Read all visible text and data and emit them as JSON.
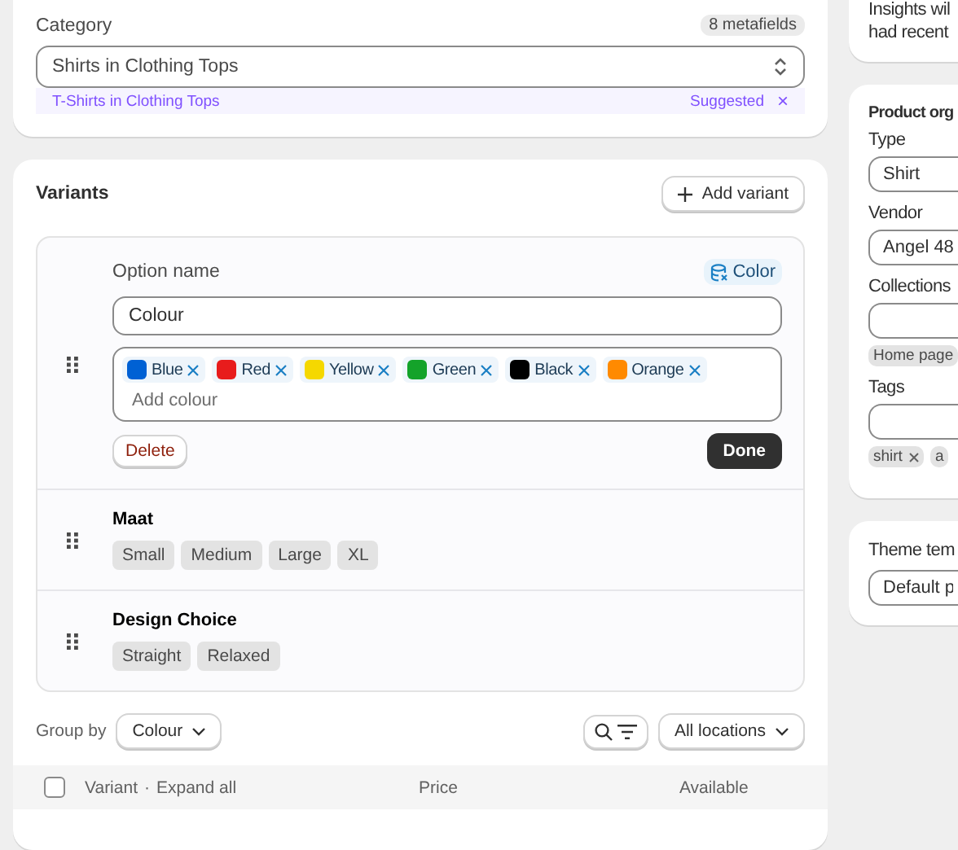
{
  "category": {
    "label": "Category",
    "metafields": "8 metafields",
    "value": "Shirts in Clothing Tops",
    "suggestion": {
      "text": "T-Shirts in Clothing Tops",
      "badge": "Suggested",
      "dismiss": "×"
    }
  },
  "variants": {
    "title": "Variants",
    "add_button": "Add variant",
    "options": [
      {
        "kind": "editing",
        "label": "Option name",
        "metafield": "Color",
        "value": "Colour",
        "values": [
          {
            "name": "Blue",
            "color": "#0061d4"
          },
          {
            "name": "Red",
            "color": "#e81c1c"
          },
          {
            "name": "Yellow",
            "color": "#f5d800"
          },
          {
            "name": "Green",
            "color": "#14a32a"
          },
          {
            "name": "Black",
            "color": "#000000"
          },
          {
            "name": "Orange",
            "color": "#ff8a00"
          }
        ],
        "placeholder": "Add colour",
        "delete": "Delete",
        "done": "Done"
      },
      {
        "kind": "summary",
        "name": "Maat",
        "values": [
          {
            "name": "Small"
          },
          {
            "name": "Medium"
          },
          {
            "name": "Large"
          },
          {
            "name": "XL"
          }
        ]
      },
      {
        "kind": "summary",
        "name": "Design Choice",
        "values": [
          {
            "name": "Straight"
          },
          {
            "name": "Relaxed"
          }
        ]
      }
    ],
    "group_by": {
      "label": "Group by",
      "value": "Colour"
    },
    "locations": "All locations",
    "table": {
      "checked": false,
      "columns": [
        {
          "label": "Variant",
          "separator": "·",
          "link": "Expand all"
        },
        {
          "label": "Price"
        },
        {
          "label": "Available"
        }
      ]
    }
  },
  "sidebar": {
    "insights": [
      "Insights wil",
      "had recent"
    ],
    "organization": {
      "title": "Product org",
      "fields": [
        {
          "label": "Type",
          "value": "Shirt"
        },
        {
          "label": "Vendor",
          "value": "Angel 48"
        },
        {
          "label": "Collections",
          "tags": [
            {
              "text": "Home page"
            }
          ]
        },
        {
          "label": "Tags",
          "tags": [
            {
              "text": "shirt",
              "removable": true
            },
            {
              "text": "a"
            }
          ]
        }
      ]
    },
    "theme": {
      "label": "Theme tem",
      "value": "Default p"
    }
  }
}
